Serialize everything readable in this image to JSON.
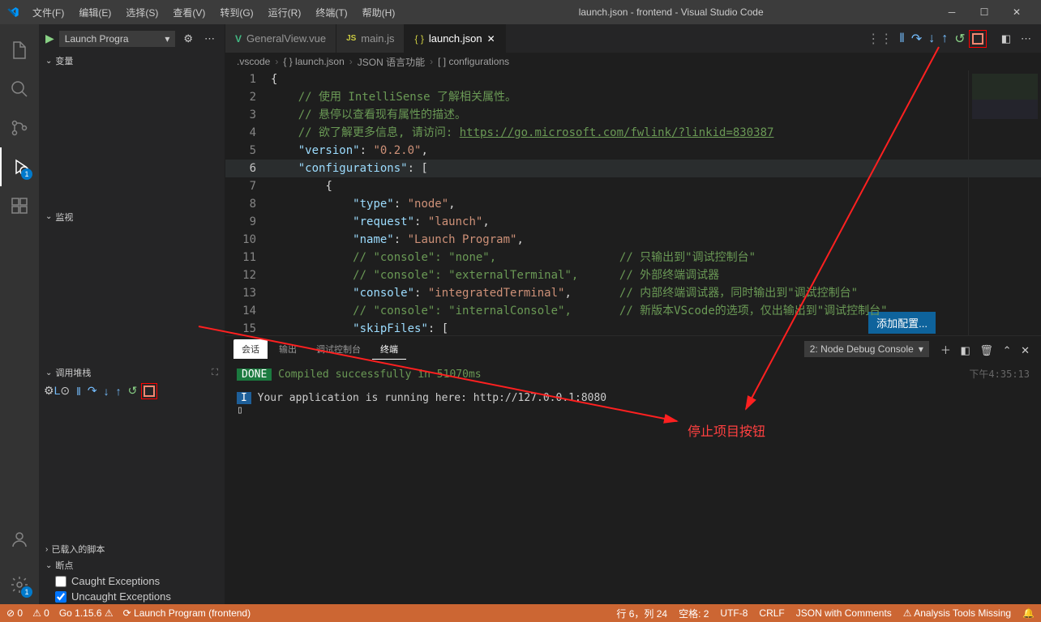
{
  "titlebar": {
    "menus": [
      "文件(F)",
      "编辑(E)",
      "选择(S)",
      "查看(V)",
      "转到(G)",
      "运行(R)",
      "终端(T)",
      "帮助(H)"
    ],
    "title": "launch.json - frontend - Visual Studio Code"
  },
  "sidebar": {
    "run_config": "Launch Progra",
    "sections": {
      "variables": "变量",
      "watch": "监视",
      "callstack": "调用堆栈",
      "loaded_scripts": "已载入的脚本",
      "breakpoints": "断点"
    },
    "bp_caught": "Caught Exceptions",
    "bp_uncaught": "Uncaught Exceptions",
    "debug_session_label": "L"
  },
  "tabs": [
    {
      "icon": "V",
      "icon_color": "#42b883",
      "label": "GeneralView.vue",
      "active": false
    },
    {
      "icon": "JS",
      "icon_color": "#cbcb41",
      "label": "main.js",
      "active": false
    },
    {
      "icon": "{ }",
      "icon_color": "#cbcb41",
      "label": "launch.json",
      "active": true
    }
  ],
  "breadcrumb": [
    ".vscode",
    "{ } launch.json",
    "JSON 语言功能",
    "[ ] configurations"
  ],
  "code": {
    "lines": [
      {
        "n": 1,
        "html": "<span class='t-punc'>{</span>"
      },
      {
        "n": 2,
        "html": "    <span class='t-comment'>// 使用 IntelliSense 了解相关属性。</span>"
      },
      {
        "n": 3,
        "html": "    <span class='t-comment'>// 悬停以查看现有属性的描述。</span>"
      },
      {
        "n": 4,
        "html": "    <span class='t-comment'>// 欲了解更多信息, 请访问: </span><span class='t-url'>https://go.microsoft.com/fwlink/?linkid=830387</span>"
      },
      {
        "n": 5,
        "html": "    <span class='t-key'>\"version\"</span><span class='t-punc'>: </span><span class='t-str'>\"0.2.0\"</span><span class='t-punc'>,</span>"
      },
      {
        "n": 6,
        "html": "    <span class='t-key'>\"configurations\"</span><span class='t-punc'>: [</span>",
        "cur": true
      },
      {
        "n": 7,
        "html": "        <span class='t-punc'>{</span>"
      },
      {
        "n": 8,
        "html": "            <span class='t-key'>\"type\"</span><span class='t-punc'>: </span><span class='t-str'>\"node\"</span><span class='t-punc'>,</span>"
      },
      {
        "n": 9,
        "html": "            <span class='t-key'>\"request\"</span><span class='t-punc'>: </span><span class='t-str'>\"launch\"</span><span class='t-punc'>,</span>"
      },
      {
        "n": 10,
        "html": "            <span class='t-key'>\"name\"</span><span class='t-punc'>: </span><span class='t-str'>\"Launch Program\"</span><span class='t-punc'>,</span>"
      },
      {
        "n": 11,
        "html": "            <span class='t-comment'>// \"console\": \"none\",</span>                  <span class='t-comment-r'>// 只输出到\"调试控制台\"</span>"
      },
      {
        "n": 12,
        "html": "            <span class='t-comment'>// \"console\": \"externalTerminal\",</span>      <span class='t-comment-r'>// 外部终端调试器</span>"
      },
      {
        "n": 13,
        "html": "            <span class='t-key'>\"console\"</span><span class='t-punc'>: </span><span class='t-str'>\"integratedTerminal\"</span><span class='t-punc'>,</span>       <span class='t-comment-r'>// 内部终端调试器，同时输出到\"调试控制台\"</span>"
      },
      {
        "n": 14,
        "html": "            <span class='t-comment'>// \"console\": \"internalConsole\",</span>       <span class='t-comment-r'>// 新版本VScode的选项，仅出输出到\"调试控制台\"</span>"
      },
      {
        "n": 15,
        "html": "            <span class='t-key'>\"skipFiles\"</span><span class='t-punc'>: [</span>"
      }
    ]
  },
  "add_config_btn": "添加配置...",
  "panel": {
    "tabs": {
      "session": "会话",
      "output": "输出",
      "debug_console": "调试控制台",
      "terminal": "终端"
    },
    "select": "2: Node Debug Console",
    "done": "DONE",
    "done_msg": "Compiled successfully in 51070ms",
    "i_badge": "I",
    "running": "Your application is running here: http://127.0.0.1:8080",
    "time": "下午4:35:13"
  },
  "annotation": "停止项目按钮",
  "statusbar": {
    "errors": "⊘ 0",
    "warnings": "⚠ 0",
    "go": "Go 1.15.6 ⚠",
    "debug": "Launch Program (frontend)",
    "pos": "行 6，列 24",
    "spaces": "空格: 2",
    "enc": "UTF-8",
    "eol": "CRLF",
    "lang": "JSON with Comments",
    "analysis": "⚠ Analysis Tools Missing",
    "bell": "🔔"
  }
}
